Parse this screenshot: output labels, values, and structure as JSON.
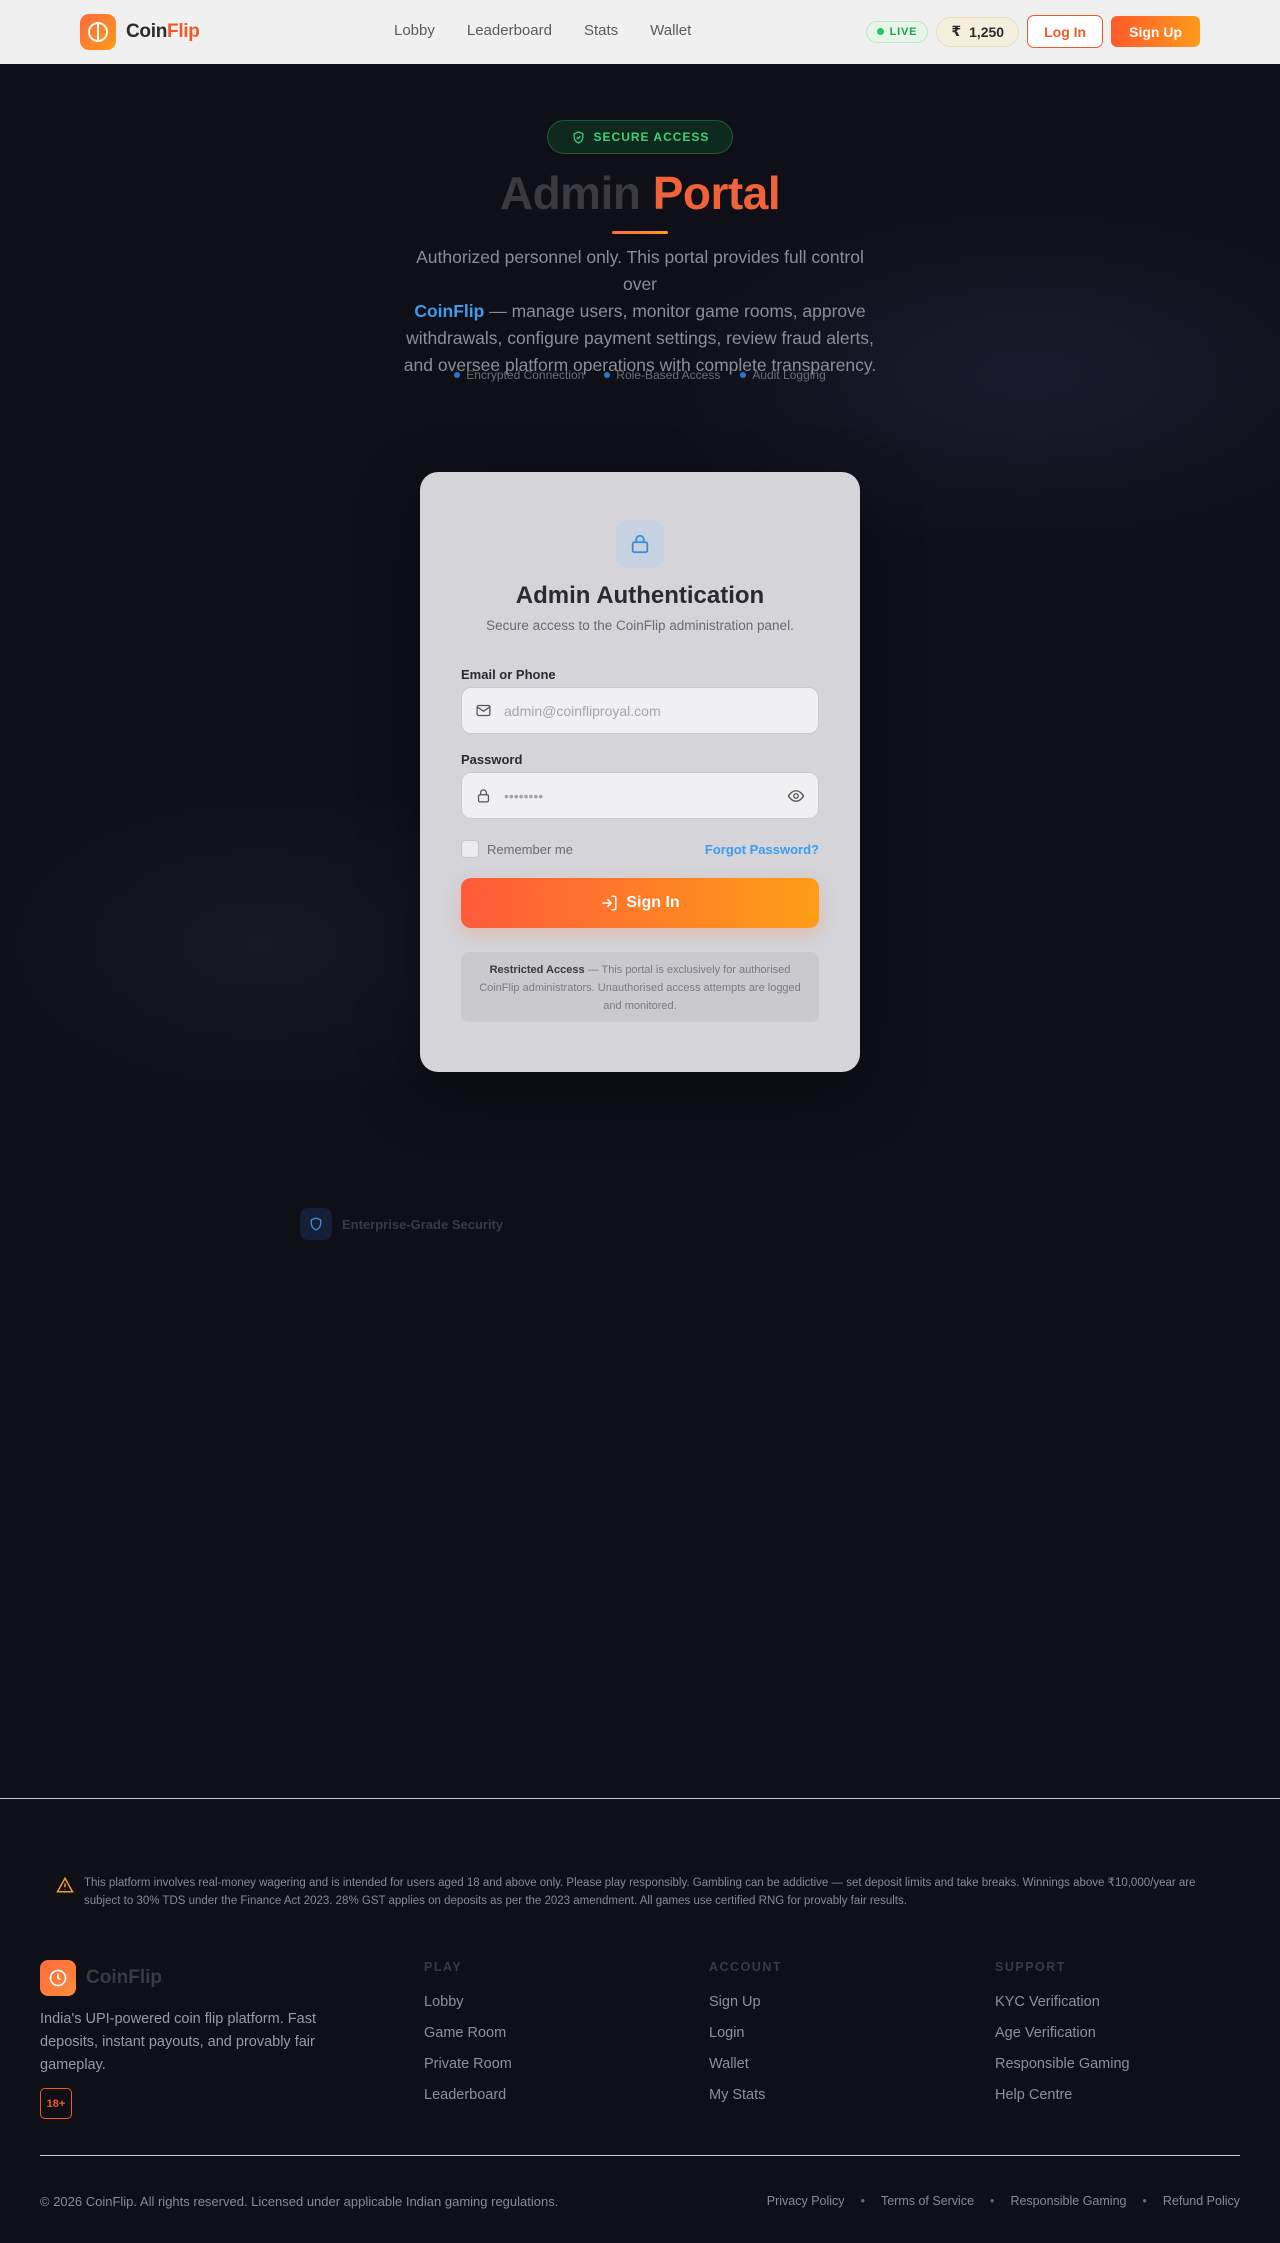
{
  "header": {
    "brand_part1": "Coin",
    "brand_part2": "Flip",
    "nav": [
      "Lobby",
      "Leaderboard",
      "Stats",
      "Wallet"
    ],
    "live_label": "LIVE",
    "currency_symbol": "₹",
    "balance": "1,250",
    "login_label": "Log In",
    "signup_label": "Sign Up"
  },
  "hero": {
    "badge": "SECURE ACCESS",
    "title_part1": "Admin",
    "title_part2": "Portal",
    "desc_before": "Authorized personnel only. This portal provides full control over",
    "desc_brand": "CoinFlip",
    "desc_after": "— manage users, monitor game rooms, approve withdrawals, configure payment settings, review fraud alerts, and oversee platform operations with complete transparency.",
    "features": [
      "Encrypted Connection",
      "Role-Based Access",
      "Audit Logging"
    ]
  },
  "card": {
    "title": "Admin Authentication",
    "subtitle": "Secure access to the CoinFlip administration panel.",
    "email_label": "Email or Phone",
    "email_placeholder": "admin@coinfliproyal.com",
    "password_label": "Password",
    "password_placeholder": "••••••••",
    "remember_label": "Remember me",
    "forgot_label": "Forgot Password?",
    "signin_label": "Sign In",
    "notice_bold": "Restricted Access",
    "notice_text": "— This portal is exclusively for authorised CoinFlip administrators. Unauthorised access attempts are logged and monitored."
  },
  "enterprise_label": "Enterprise-Grade Security",
  "footer": {
    "disclaimer": "This platform involves real-money wagering and is intended for users aged 18 and above only. Please play responsibly. Gambling can be addictive — set deposit limits and take breaks. Winnings above ₹10,000/year are subject to 30% TDS under the Finance Act 2023. 28% GST applies on deposits as per the 2023 amendment. All games use certified RNG for provably fair results.",
    "brand": "CoinFlip",
    "tagline": "India's UPI-powered coin flip platform. Fast deposits, instant payouts, and provably fair gameplay.",
    "age_badge": "18+",
    "columns": [
      {
        "heading": "PLAY",
        "links": [
          "Lobby",
          "Game Room",
          "Private Room",
          "Leaderboard"
        ]
      },
      {
        "heading": "ACCOUNT",
        "links": [
          "Sign Up",
          "Login",
          "Wallet",
          "My Stats"
        ]
      },
      {
        "heading": "SUPPORT",
        "links": [
          "KYC Verification",
          "Age Verification",
          "Responsible Gaming",
          "Help Centre"
        ]
      }
    ],
    "copyright": "© 2026 CoinFlip. All rights reserved. Licensed under applicable Indian gaming regulations.",
    "legal_links": [
      "Privacy Policy",
      "Terms of Service",
      "Responsible Gaming",
      "Refund Policy"
    ]
  },
  "colors": {
    "accent_orange": "#f05a2a",
    "accent_blue": "#3c9cf0",
    "live_green": "#22c55e",
    "background": "#0f0f17"
  }
}
